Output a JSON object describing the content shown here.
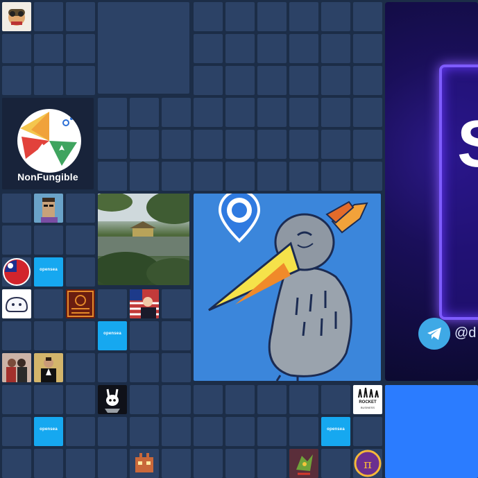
{
  "nonfungible": {
    "label": "NonFungible"
  },
  "advertisement": {
    "big_letter": "S",
    "handle": "@d"
  },
  "tiles": {
    "opensea_badge": "opensea",
    "rocket_name": "ROCKET",
    "rocket_sub": "BUSINESS"
  },
  "colors": {
    "background": "#1c2d47",
    "cell": "#2c4266",
    "bird_bg": "#3b86db",
    "ad_accent": "#7e5cff",
    "badge_blue": "#16a8f0",
    "blue_block": "#2b7cff"
  }
}
